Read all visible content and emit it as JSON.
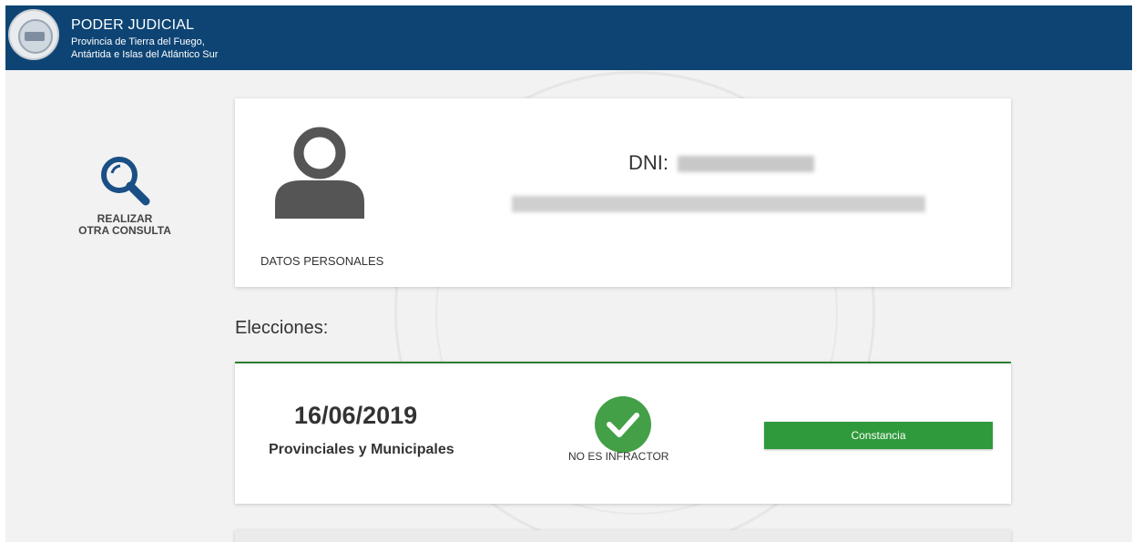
{
  "header": {
    "title": "PODER JUDICIAL",
    "subtitle_line1": "Provincia de Tierra del Fuego,",
    "subtitle_line2": "Antártida e Islas del Atlántico Sur"
  },
  "sidebar": {
    "search_label": "REALIZAR\nOTRA CONSULTA",
    "icon": "search-icon"
  },
  "personal": {
    "section_label": "DATOS PERSONALES",
    "dni_prefix": "DNI:"
  },
  "elecciones": {
    "title": "Elecciones:",
    "items": [
      {
        "date": "16/06/2019",
        "type": "Provinciales y Municipales",
        "status": "NO ES INFRACTOR",
        "button_label": "Constancia"
      }
    ]
  },
  "colors": {
    "header_bg": "#0d4474",
    "accent_green": "#2f9a3b",
    "status_check": "#43a047"
  }
}
